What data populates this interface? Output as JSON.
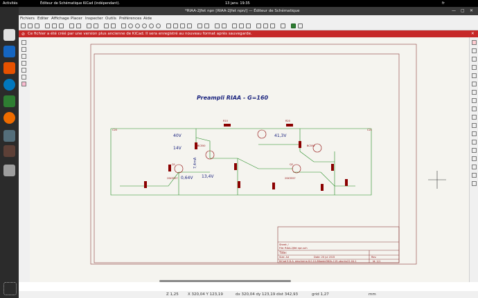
{
  "topbar": {
    "activities": "Activités",
    "app": "Éditeur de Schématique KiCad (indépendant).",
    "clock": "13 janv. 19:35",
    "locale": "fr"
  },
  "window": {
    "title": "*RIAA-2Jfet npn [RIAA-2Jfet npn/] — Éditeur de Schématique"
  },
  "menu": {
    "items": [
      "Fichiers",
      "Editer",
      "Affichage",
      "Placer",
      "Inspecter",
      "Outils",
      "Préférences",
      "Aide"
    ]
  },
  "notification": {
    "text": "Ce fichier a été créé par une version plus ancienne de KiCad. Il sera enregistré au nouveau format après sauvegarde."
  },
  "schematic": {
    "title": "Preampli RIAA - G=160",
    "voltages": [
      "40V",
      "14V",
      "41,3V",
      "13,4V",
      "0,64V",
      "7,4mA"
    ],
    "parts": [
      "Q1",
      "Q2",
      "2SK3557",
      "2SK3557",
      "BC550",
      "BC550",
      "R10",
      "R20",
      "C20",
      "C21"
    ],
    "titleblock": {
      "sheet": "Sheet: /",
      "file": "File: RIAA-2Jfet npn.sch",
      "title_label": "Title:",
      "size": "Size: A4",
      "date": "Date: 20 jul 2015",
      "rev": "Rev:",
      "kicad": "KiCad E.D.A. eeschema 6.0.10-86aedd382b-119-ubuntu22.04.1",
      "id": "Id: 1/1"
    }
  },
  "status": {
    "zoom": "Z 1,25",
    "xy": "X 320,04  Y 123,19",
    "dxy": "dx 320,04  dy 123,19  dist 342,93",
    "grid": "grid 1,27",
    "units": "mm"
  }
}
